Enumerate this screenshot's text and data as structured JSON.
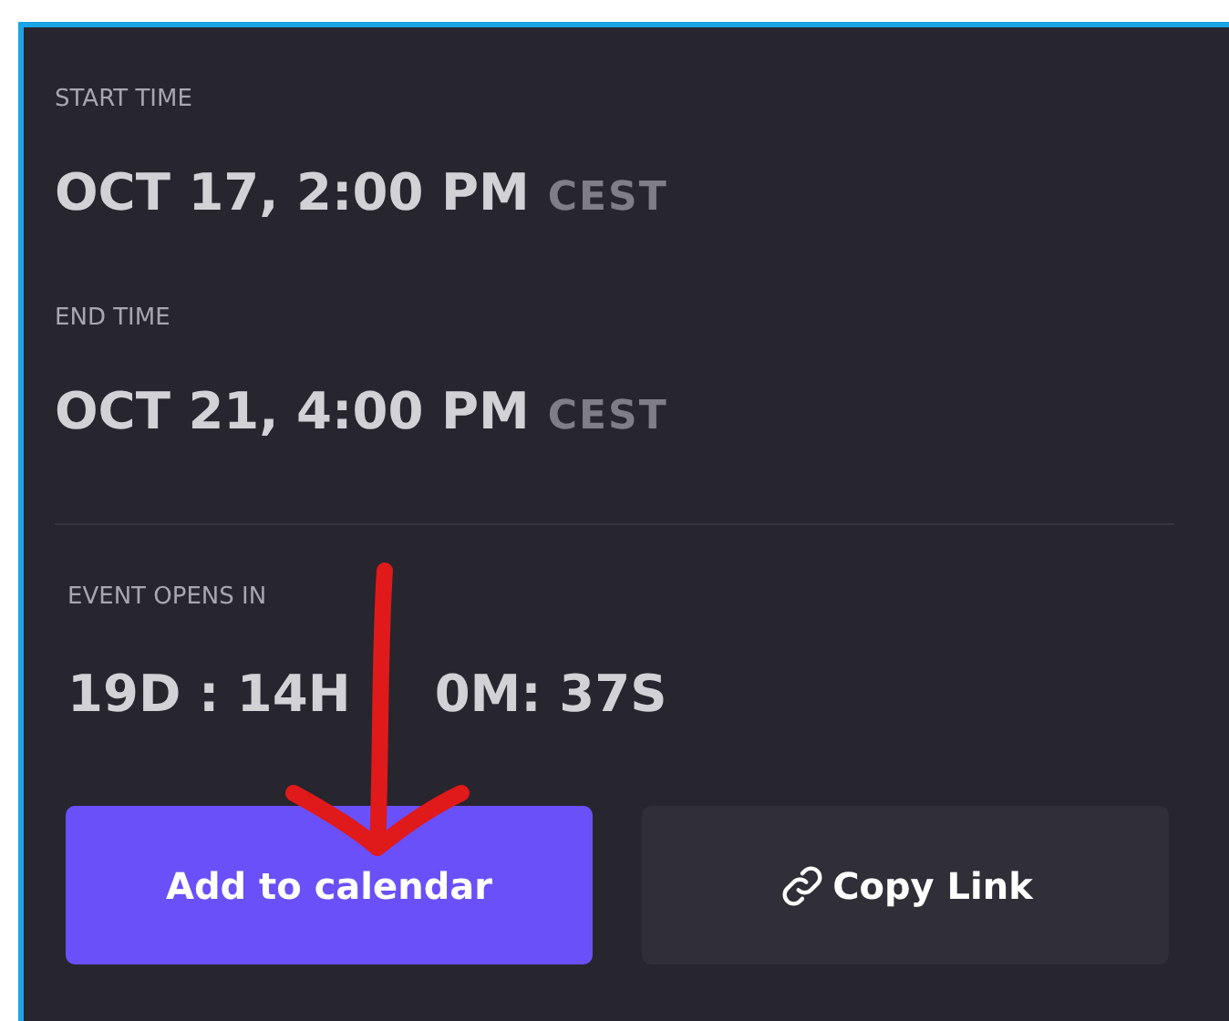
{
  "times": [
    {
      "label": "START TIME",
      "value": "OCT 17, 2:00 PM",
      "zone": "CEST"
    },
    {
      "label": "END TIME",
      "value": "OCT 21, 4:00 PM",
      "zone": "CEST"
    }
  ],
  "countdown": {
    "label": "EVENT OPENS IN",
    "parts": [
      "19D : 14H",
      "0M: 37S"
    ]
  },
  "buttons": [
    {
      "kind": "primary",
      "label": "Add to calendar"
    },
    {
      "kind": "link",
      "label": "Copy Link"
    }
  ],
  "annotation": {
    "kind": "arrow"
  }
}
